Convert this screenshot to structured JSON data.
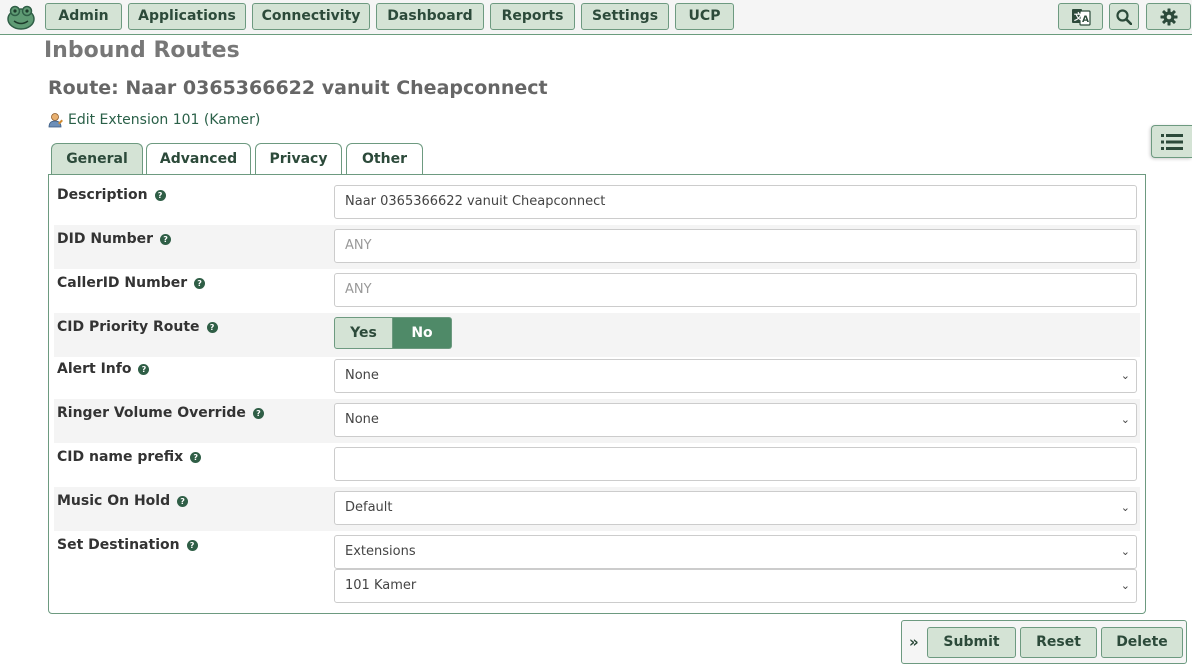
{
  "nav": {
    "items": [
      {
        "label": "Admin"
      },
      {
        "label": "Applications"
      },
      {
        "label": "Connectivity"
      },
      {
        "label": "Dashboard"
      },
      {
        "label": "Reports"
      },
      {
        "label": "Settings"
      },
      {
        "label": "UCP"
      }
    ],
    "icons": [
      "language-icon",
      "search-icon",
      "gear-icon"
    ]
  },
  "page": {
    "title": "Inbound Routes",
    "route_title": "Route: Naar 0365366622 vanuit Cheapconnect",
    "edit_link": "Edit Extension 101 (Kamer)"
  },
  "tabs": [
    {
      "label": "General",
      "active": true
    },
    {
      "label": "Advanced",
      "active": false
    },
    {
      "label": "Privacy",
      "active": false
    },
    {
      "label": "Other",
      "active": false
    }
  ],
  "form": {
    "description": {
      "label": "Description",
      "value": "Naar 0365366622 vanuit Cheapconnect"
    },
    "did_number": {
      "label": "DID Number",
      "placeholder": "ANY"
    },
    "callerid_number": {
      "label": "CallerID Number",
      "placeholder": "ANY"
    },
    "cid_priority": {
      "label": "CID Priority Route",
      "yes": "Yes",
      "no": "No",
      "selected": "No"
    },
    "alert_info": {
      "label": "Alert Info",
      "value": "None"
    },
    "ringer_volume": {
      "label": "Ringer Volume Override",
      "value": "None"
    },
    "cid_prefix": {
      "label": "CID name prefix",
      "value": ""
    },
    "music_on_hold": {
      "label": "Music On Hold",
      "value": "Default"
    },
    "destination": {
      "label": "Set Destination",
      "type": "Extensions",
      "target": "101 Kamer"
    }
  },
  "actions": {
    "submit": "Submit",
    "reset": "Reset",
    "delete": "Delete"
  },
  "colors": {
    "accent": "#d4e3d5",
    "border": "#6d9a80",
    "active_toggle": "#4f8a68"
  }
}
